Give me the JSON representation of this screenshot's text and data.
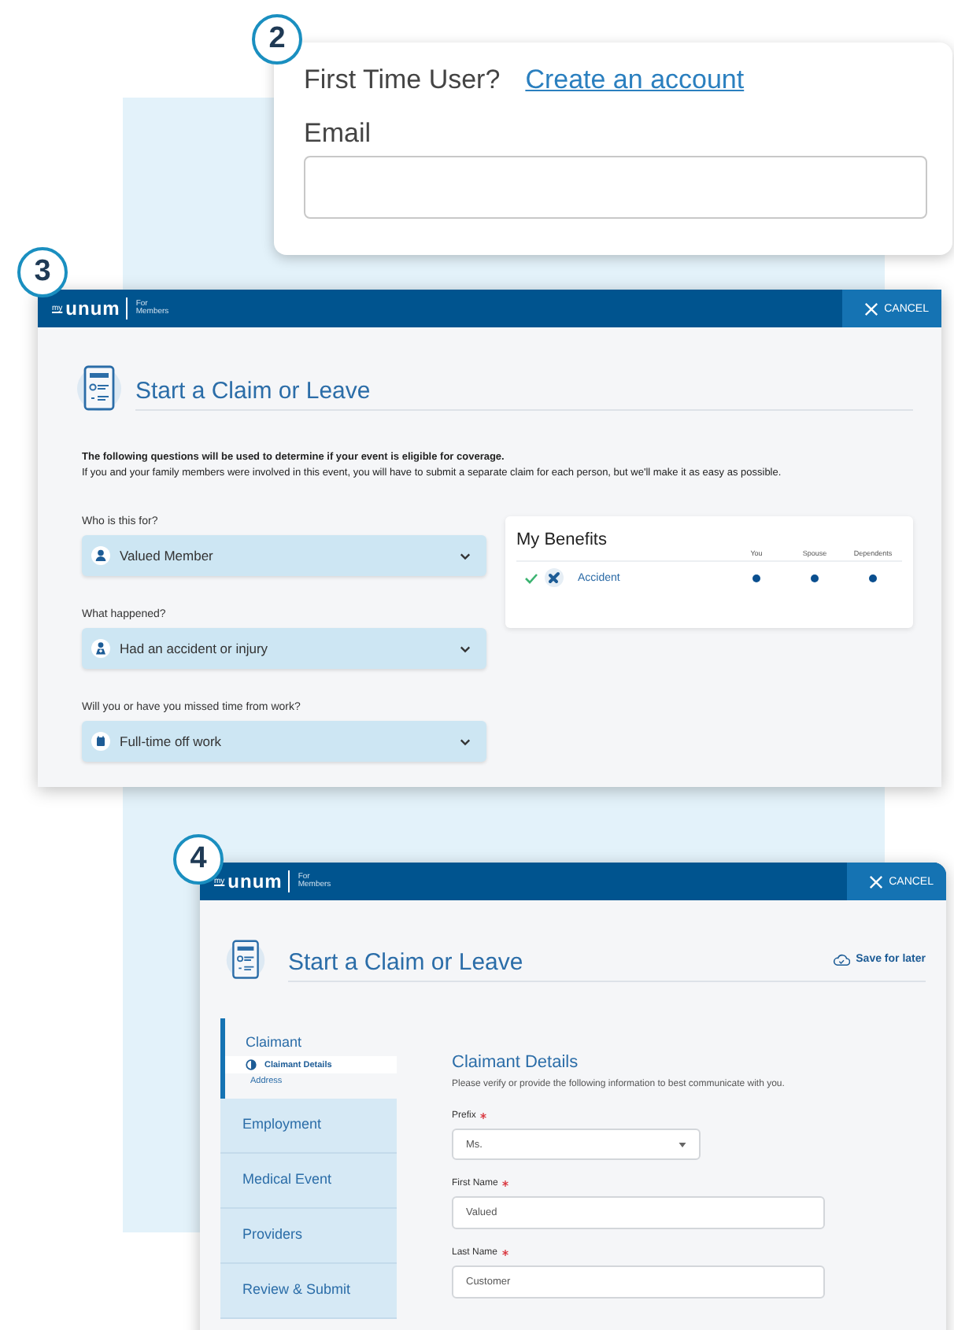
{
  "login_card": {
    "step": "2",
    "prompt": "First Time User?",
    "link": "Create an account",
    "email_label": "Email"
  },
  "claim_start": {
    "step": "3",
    "logo": {
      "my": "my",
      "brand": "unum",
      "sub_1": "For",
      "sub_2": "Members"
    },
    "cancel": "CANCEL",
    "title": "Start a Claim or Leave",
    "intro_bold": "The following questions will be used to determine if your event is eligible for coverage.",
    "intro": "If you and your family members were involved in this event, you will have to submit a separate claim for each person, but we'll make it as easy as possible.",
    "questions": [
      {
        "label": "Who is this for?",
        "value": "Valued Member"
      },
      {
        "label": "What happened?",
        "value": "Had an accident or injury"
      },
      {
        "label": "Will you or have you missed time from work?",
        "value": "Full-time off work"
      }
    ],
    "benefits": {
      "title": "My Benefits",
      "columns": [
        "You",
        "Spouse",
        "Dependents"
      ],
      "rows": [
        {
          "name": "Accident",
          "checked": true,
          "covered": [
            true,
            true,
            true
          ]
        }
      ]
    }
  },
  "claim_details": {
    "step": "4",
    "logo": {
      "my": "my",
      "brand": "unum",
      "sub_1": "For",
      "sub_2": "Members"
    },
    "cancel": "CANCEL",
    "title": "Start a Claim or Leave",
    "save": "Save for later",
    "steps": [
      {
        "label": "Claimant",
        "selected": true,
        "children": [
          {
            "label": "Claimant Details",
            "selected": true
          },
          {
            "label": "Address",
            "selected": false
          }
        ]
      },
      {
        "label": "Employment",
        "selected": false
      },
      {
        "label": "Medical Event",
        "selected": false
      },
      {
        "label": "Providers",
        "selected": false
      },
      {
        "label": "Review & Submit",
        "selected": false
      }
    ],
    "section_title": "Claimant Details",
    "section_text": "Please verify or provide the following information to best communicate with you.",
    "fields": [
      {
        "kind": "select",
        "label": "Prefix",
        "required": true,
        "value": "Ms."
      },
      {
        "kind": "text",
        "label": "First Name",
        "required": true,
        "value": "Valued"
      },
      {
        "kind": "text",
        "label": "Last Name",
        "required": true,
        "value": "Customer"
      }
    ]
  }
}
